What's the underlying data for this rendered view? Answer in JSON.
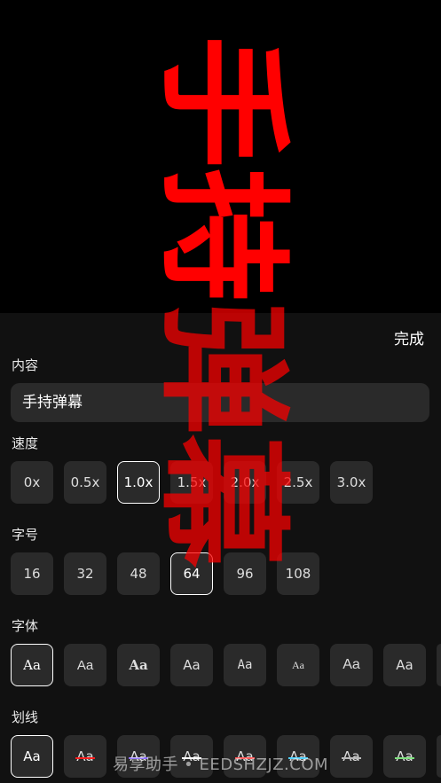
{
  "preview": {
    "danmaku_text": "手持弹幕",
    "text_color": "#ff0000"
  },
  "header": {
    "done_label": "完成"
  },
  "content": {
    "label": "内容",
    "value": "手持弹幕"
  },
  "speed": {
    "label": "速度",
    "options": [
      "0x",
      "0.5x",
      "1.0x",
      "1.5x",
      "2.0x",
      "2.5x",
      "3.0x"
    ],
    "selected": "1.0x"
  },
  "size": {
    "label": "字号",
    "options": [
      "16",
      "32",
      "48",
      "64",
      "96",
      "108"
    ],
    "selected": "64"
  },
  "font": {
    "label": "字体",
    "sample": "Aa",
    "selected_index": 0
  },
  "stroke": {
    "label": "划线",
    "sample": "Aa",
    "selected_index": 0,
    "colors": [
      "",
      "#ff2020",
      "#8a6cff",
      "#ffffff",
      "#ff5a5a",
      "#4fd0ff",
      "#bbbbbb",
      "#7ee07e"
    ]
  },
  "watermark": "易享助手 • EEDSHZJZ.COM",
  "colors": {
    "panel_bg": "#111111",
    "button_bg": "#2a2a2a",
    "selected_border": "#ffffff"
  }
}
